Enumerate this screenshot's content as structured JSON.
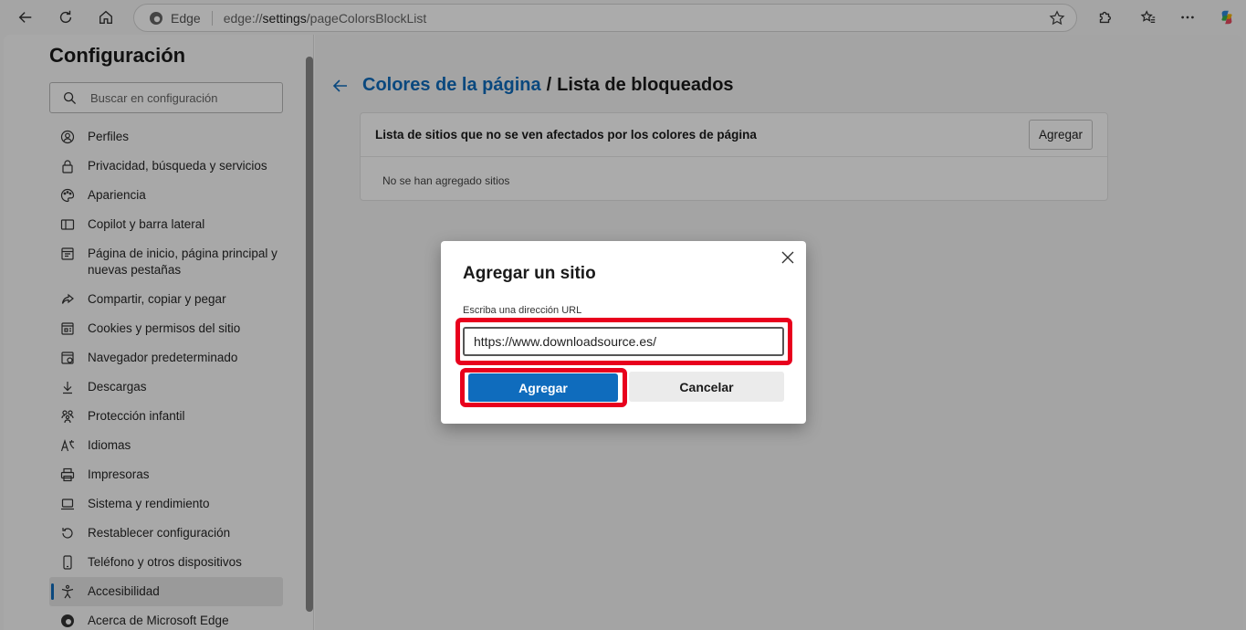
{
  "browser": {
    "site_name": "Edge",
    "url_prefix": "edge://",
    "url_host": "settings",
    "url_path": "/pageColorsBlockList"
  },
  "sidebar": {
    "title": "Configuración",
    "search_placeholder": "Buscar en configuración",
    "items": [
      {
        "label": "Perfiles",
        "icon": "profile-icon"
      },
      {
        "label": "Privacidad, búsqueda y servicios",
        "icon": "lock-icon"
      },
      {
        "label": "Apariencia",
        "icon": "palette-icon"
      },
      {
        "label": "Copilot y barra lateral",
        "icon": "sidebar-icon"
      },
      {
        "label": "Página de inicio, página principal y nuevas pestañas",
        "icon": "home-page-icon"
      },
      {
        "label": "Compartir, copiar y pegar",
        "icon": "share-icon"
      },
      {
        "label": "Cookies y permisos del sitio",
        "icon": "cookie-icon"
      },
      {
        "label": "Navegador predeterminado",
        "icon": "browser-icon"
      },
      {
        "label": "Descargas",
        "icon": "download-icon"
      },
      {
        "label": "Protección infantil",
        "icon": "family-icon"
      },
      {
        "label": "Idiomas",
        "icon": "language-icon"
      },
      {
        "label": "Impresoras",
        "icon": "printer-icon"
      },
      {
        "label": "Sistema y rendimiento",
        "icon": "laptop-icon"
      },
      {
        "label": "Restablecer configuración",
        "icon": "reset-icon"
      },
      {
        "label": "Teléfono y otros dispositivos",
        "icon": "phone-icon"
      },
      {
        "label": "Accesibilidad",
        "icon": "accessibility-icon"
      },
      {
        "label": "Acerca de Microsoft Edge",
        "icon": "edge-icon"
      }
    ]
  },
  "main": {
    "breadcrumb_parent": "Colores de la página",
    "breadcrumb_separator": "/",
    "breadcrumb_current": "Lista de bloqueados",
    "card_title": "Lista de sitios que no se ven afectados por los colores de página",
    "add_button": "Agregar",
    "empty_text": "No se han agregado sitios"
  },
  "dialog": {
    "title": "Agregar un sitio",
    "field_label": "Escriba una dirección URL",
    "field_value": "https://www.downloadsource.es/",
    "primary_button": "Agregar",
    "secondary_button": "Cancelar"
  },
  "colors": {
    "accent": "#0f6cbd",
    "highlight": "#e8001d"
  }
}
